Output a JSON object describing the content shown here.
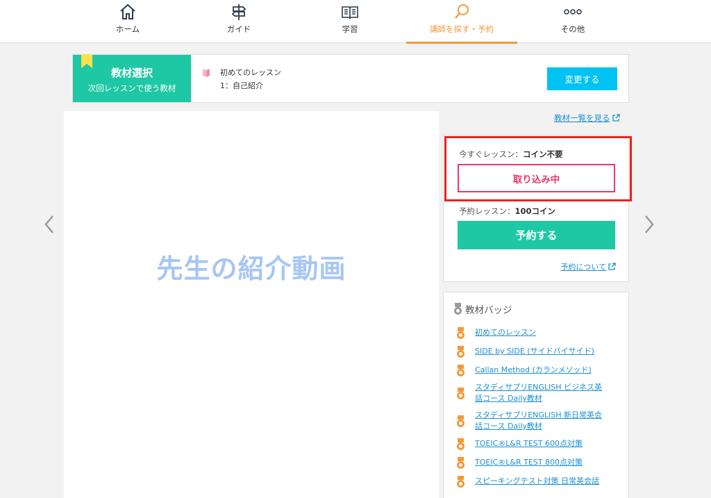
{
  "nav": {
    "home": "ホーム",
    "guide": "ガイド",
    "study": "学習",
    "find": "講師を探す・予約",
    "other": "その他"
  },
  "material": {
    "title": "教材選択",
    "subtitle": "次回レッスンで使う教材",
    "course_name": "初めてのレッスン",
    "lesson_name": "1：自己紹介",
    "change_label": "変更する"
  },
  "video": {
    "title": "先生の紹介動画"
  },
  "links": {
    "material_list": "教材一覧を見る"
  },
  "booking": {
    "now_prefix": "今すぐレッスン：",
    "now_value": "コイン不要",
    "importing_label": "取り込み中",
    "reserve_prefix": "予約レッスン：",
    "reserve_value": "100コイン",
    "reserve_button": "予約する",
    "about_link": "予約について"
  },
  "badges": {
    "title": "教材バッジ",
    "items": [
      "初めてのレッスン",
      "SIDE by SIDE (サイドバイサイド)",
      "Callan Method (カランメソッド)",
      "スタディサプリENGLISH ビジネス英\n話コース Daily教材",
      "スタディサプリENGLISH 新日常英会\n話コース Daily教材",
      "TOEIC®L&R TEST 600点対策",
      "TOEIC®L&R TEST 800点対策",
      "スピーキングテスト対策 日常英会話"
    ]
  },
  "colors": {
    "accent_green": "#1ec8a4",
    "accent_orange": "#f29a3a",
    "accent_blue": "#00c2f3",
    "highlight_red": "#e8231a",
    "importing_pink": "#e6396b"
  }
}
